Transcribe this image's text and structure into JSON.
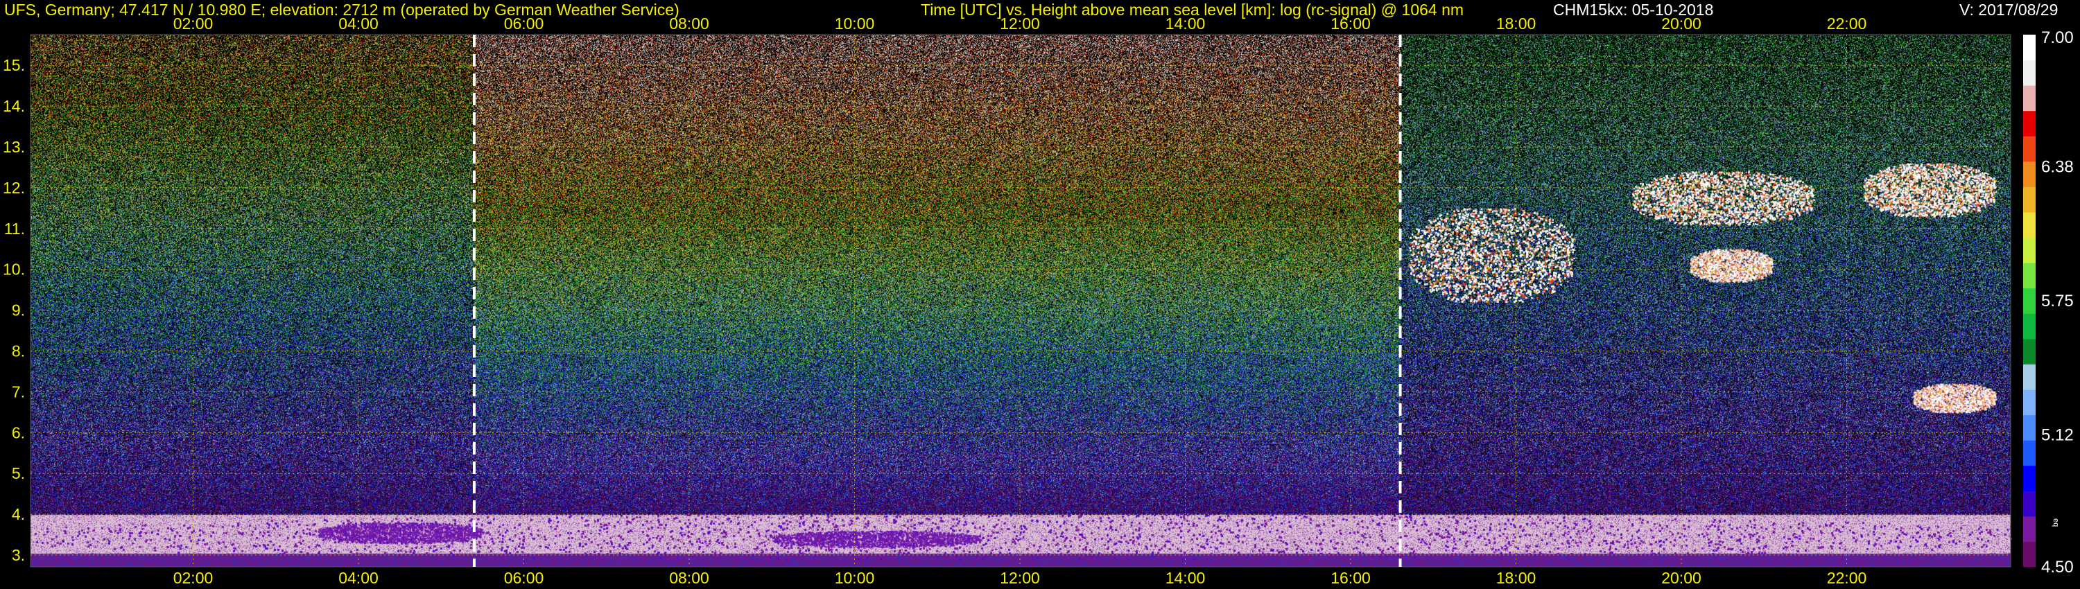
{
  "header": {
    "station": "UFS, Germany; 47.417 N / 10.980 E; elevation: 2712 m  (operated by German Weather Service)",
    "plot_title": "Time [UTC] vs. Height above mean sea level [km]: log (rc-signal) @ 1064 nm",
    "instrument": "CHM15kx: 05-10-2018",
    "version": "V: 2017/08/29"
  },
  "colors": {
    "background": "#000000",
    "text_yellow": "#f4f000",
    "grid": "#d8d000",
    "marker_line": "#ffffff"
  },
  "chart_data": {
    "type": "heatmap",
    "title": "Time [UTC] vs. Height above mean sea level [km]: log (rc-signal) @ 1064 nm",
    "xlabel": "Time [UTC]",
    "ylabel": "Height above mean sea level [km]",
    "x_ticks": [
      "02:00",
      "04:00",
      "06:00",
      "08:00",
      "10:00",
      "12:00",
      "14:00",
      "16:00",
      "18:00",
      "20:00",
      "22:00"
    ],
    "x_tick_hours": [
      2,
      4,
      6,
      8,
      10,
      12,
      14,
      16,
      18,
      20,
      22
    ],
    "xlim_hours": [
      0,
      24
    ],
    "y_ticks": [
      "3.",
      "4.",
      "5.",
      "6.",
      "7.",
      "8.",
      "9.",
      "10.",
      "11.",
      "12.",
      "13.",
      "14.",
      "15."
    ],
    "y_tick_values": [
      3,
      4,
      5,
      6,
      7,
      8,
      9,
      10,
      11,
      12,
      13,
      14,
      15
    ],
    "ylim_km": [
      2.712,
      15.75
    ],
    "grid": true,
    "marker_lines_hours": [
      5.4,
      16.6
    ],
    "colorbar": {
      "ticks": [
        "7.00",
        "6.38",
        "5.75",
        "5.12",
        "4.50"
      ],
      "tick_values": [
        7.0,
        6.38,
        5.75,
        5.12,
        4.5
      ],
      "range": [
        4.5,
        7.0
      ],
      "unit_label": "eq",
      "colors": [
        "#6a0a6a",
        "#7a1aa0",
        "#3a00c8",
        "#0000ff",
        "#1e5aff",
        "#4c8cff",
        "#7fb2ff",
        "#a8cfe8",
        "#0a8a2a",
        "#10b840",
        "#32d23c",
        "#78e640",
        "#c8f040",
        "#f0e23c",
        "#f0b428",
        "#f08c1e",
        "#f04614",
        "#e60000",
        "#e8b0b0",
        "#f0f0f0",
        "#ffffff"
      ]
    },
    "features": [
      {
        "name": "boundary layer",
        "hours": [
          0,
          24
        ],
        "km": [
          2.9,
          4.0
        ]
      },
      {
        "name": "aerosol layer",
        "hours": [
          3.5,
          5.5
        ],
        "km": [
          3.3,
          3.8
        ]
      },
      {
        "name": "aerosol layer",
        "hours": [
          9.0,
          11.5
        ],
        "km": [
          3.2,
          3.6
        ]
      },
      {
        "name": "cloud",
        "hours": [
          16.7,
          18.7
        ],
        "km": [
          9.2,
          11.5
        ]
      },
      {
        "name": "cloud",
        "hours": [
          19.4,
          21.6
        ],
        "km": [
          11.1,
          12.4
        ]
      },
      {
        "name": "cloud",
        "hours": [
          20.1,
          21.1
        ],
        "km": [
          9.7,
          10.5
        ]
      },
      {
        "name": "cloud",
        "hours": [
          22.2,
          23.8
        ],
        "km": [
          11.3,
          12.6
        ]
      },
      {
        "name": "cloud",
        "hours": [
          22.8,
          23.8
        ],
        "km": [
          6.5,
          7.2
        ]
      }
    ]
  }
}
